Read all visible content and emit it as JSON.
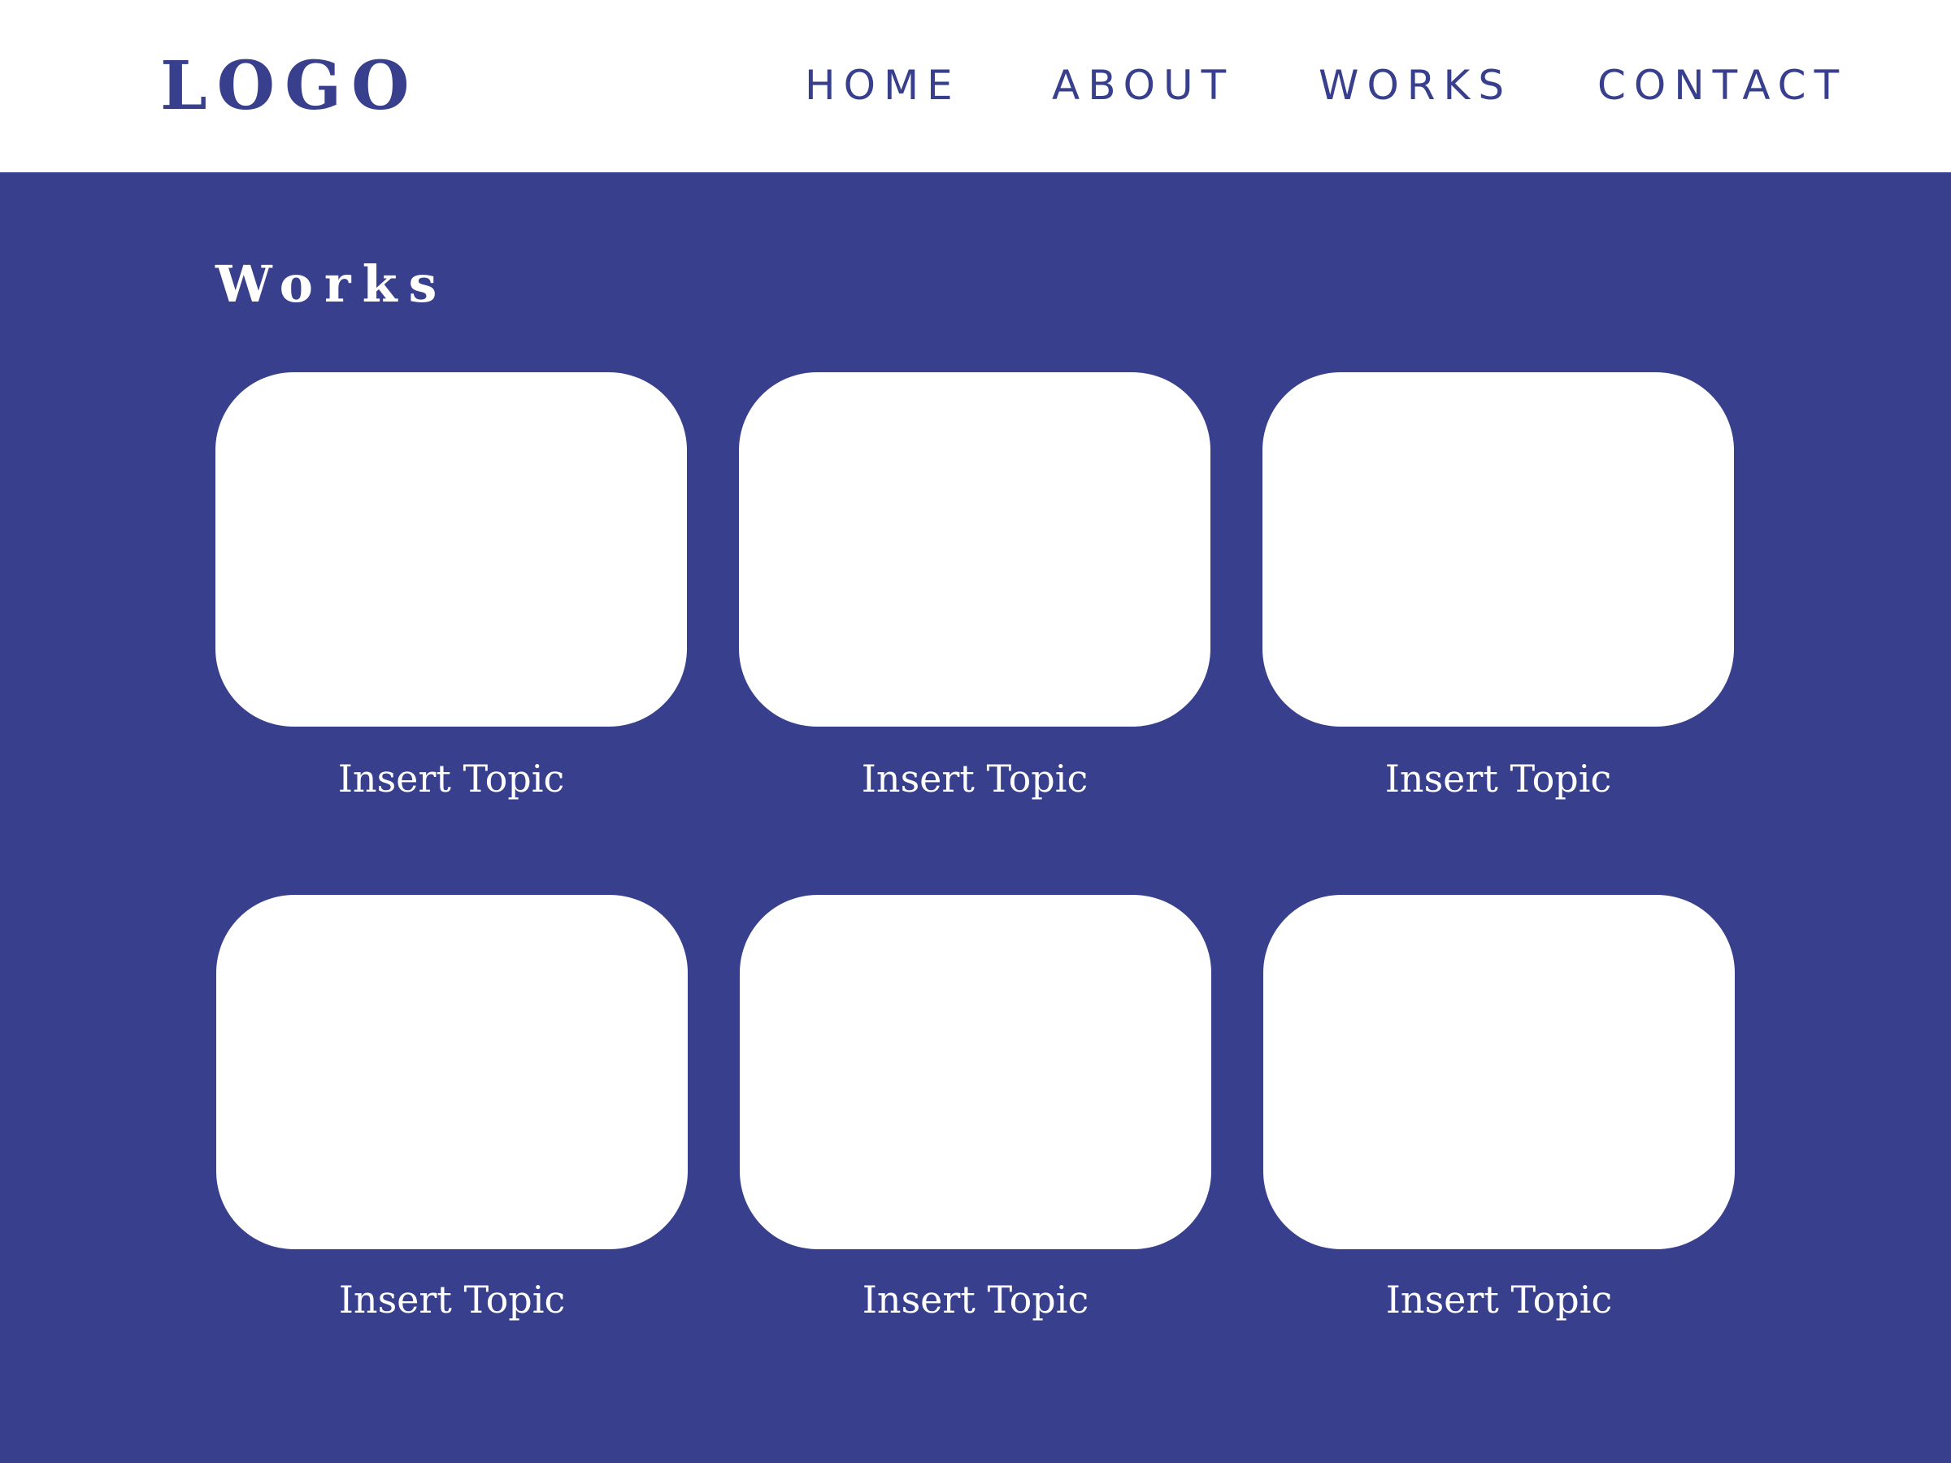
{
  "header": {
    "logo": "LOGO",
    "nav": {
      "home": "HOME",
      "about": "ABOUT",
      "works": "WORKS",
      "contact": "CONTACT"
    }
  },
  "main": {
    "title": "Works",
    "cards": [
      {
        "label": "Insert Topic"
      },
      {
        "label": "Insert Topic"
      },
      {
        "label": "Insert Topic"
      },
      {
        "label": "Insert Topic"
      },
      {
        "label": "Insert Topic"
      },
      {
        "label": "Insert Topic"
      }
    ]
  },
  "colors": {
    "primary": "#383f8c",
    "background": "#ffffff",
    "text_on_primary": "#ffffff"
  }
}
